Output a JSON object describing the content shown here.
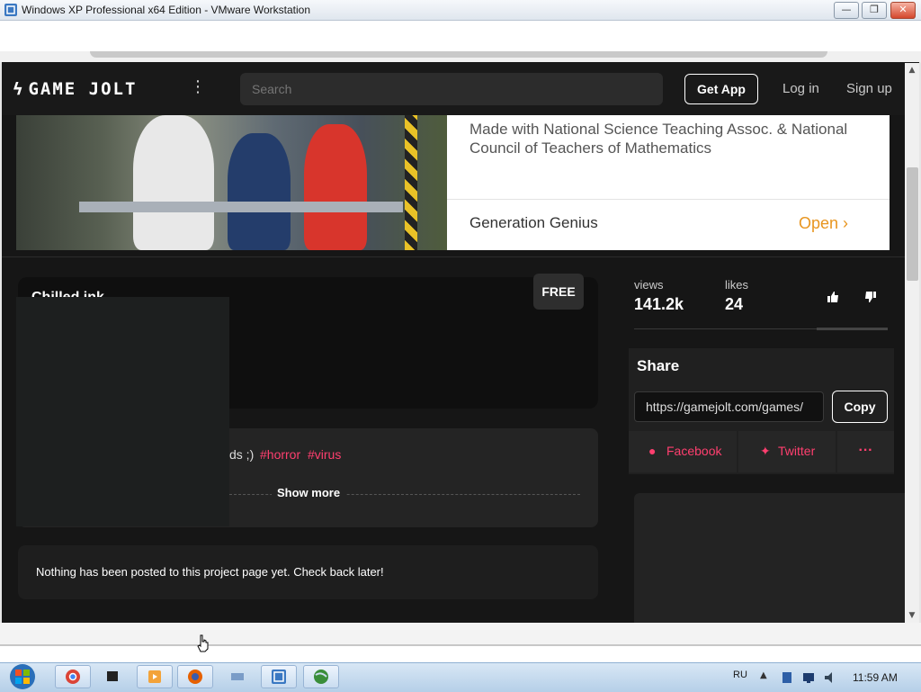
{
  "vm_window": {
    "title": "Windows XP Professional x64 Edition - VMware Workstation",
    "minimize": "—",
    "maximize": "❐",
    "close": "✕"
  },
  "gamejolt": {
    "logo_text": "GAME JOLT",
    "search_placeholder": "Search",
    "get_app": "Get App",
    "login": "Log in",
    "signup": "Sign up"
  },
  "ad": {
    "description": "Made with National Science Teaching Assoc. & National Council of Teachers of Mathematics",
    "advertiser": "Generation Genius",
    "open_label": "Open"
  },
  "game": {
    "title": "Chilled ink",
    "price_badge": "FREE",
    "description_fragment": "ds ;)",
    "tags": [
      "#horror",
      "#virus"
    ],
    "show_more": "Show more",
    "no_posts": "Nothing has been posted to this project page yet. Check back later!"
  },
  "stats": {
    "views_label": "views",
    "views_value": "141.2k",
    "likes_label": "likes",
    "likes_value": "24"
  },
  "share": {
    "title": "Share",
    "url": "https://gamejolt.com/games/",
    "copy": "Copy",
    "facebook": "Facebook",
    "twitter": "Twitter",
    "more": "···"
  },
  "taskbar": {
    "language": "RU",
    "clock": "11:59 AM",
    "apps": [
      "chrome-icon",
      "terminal-icon",
      "media-player-icon",
      "firefox-icon",
      "network-icon",
      "vmware-icon",
      "globe-icon"
    ]
  },
  "colors": {
    "accent_pink": "#ff3f6f",
    "ad_open_orange": "#e8951f",
    "page_bg": "#161616"
  }
}
